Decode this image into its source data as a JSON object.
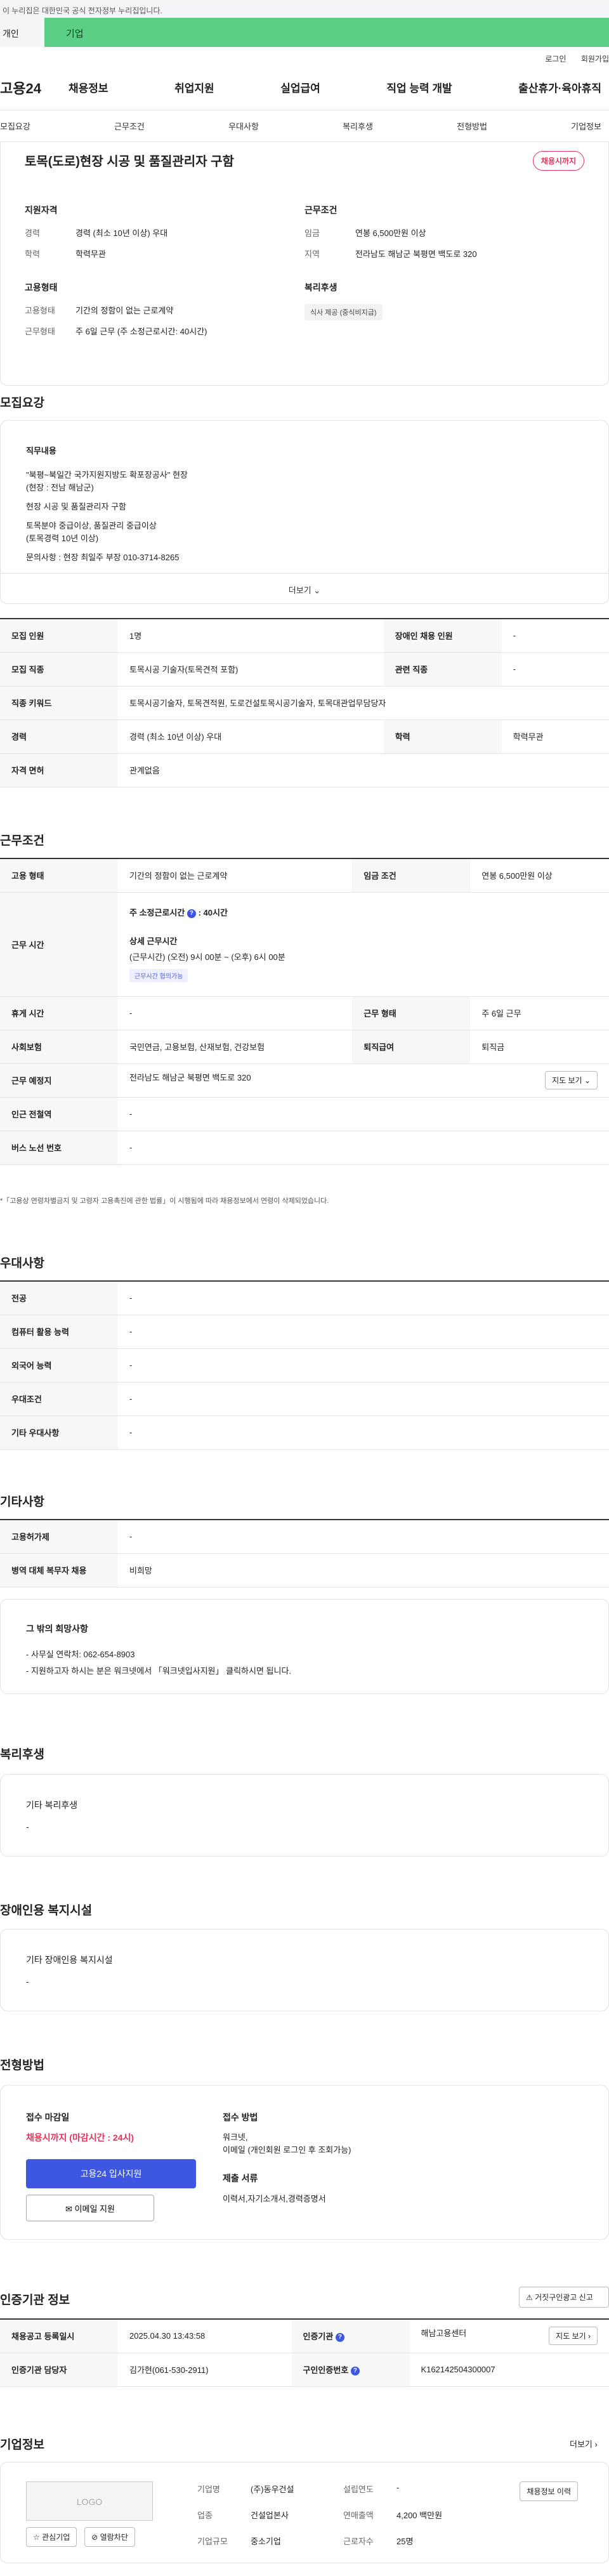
{
  "gov_banner": "이 누리집은 대한민국 공식 전자정부 누리집입니다.",
  "tabs": {
    "person": "개인",
    "company": "기업"
  },
  "util": {
    "login": "로그인",
    "join": "회원가입"
  },
  "logo": "고용24",
  "gnb": [
    "채용정보",
    "취업지원",
    "실업급여",
    "직업 능력 개발",
    "출산휴가·육아휴직"
  ],
  "anchors": [
    "모집요강",
    "근무조건",
    "우대사항",
    "복리후생",
    "전형방법",
    "기업정보"
  ],
  "summary": {
    "title": "토목(도로)현장 시공 및 품질관리자 구함",
    "badge": "채용시까지",
    "qualification": {
      "heading": "지원자격",
      "career_k": "경력",
      "career_v": "경력 (최소 10년 이상) 우대",
      "edu_k": "학력",
      "edu_v": "학력무관"
    },
    "condition": {
      "heading": "근무조건",
      "wage_k": "임금",
      "wage_v": "연봉 6,500만원 이상",
      "region_k": "지역",
      "region_v": "전라남도 해남군 북평면 백도로 320"
    },
    "employment": {
      "heading": "고용형태",
      "type_k": "고용형태",
      "type_v": "기간의 정함이 없는 근로계약",
      "work_k": "근무형태",
      "work_v": "주 6일 근무 (주 소정근로시간: 40시간)"
    },
    "welfare": {
      "heading": "복리후생",
      "chip": "식사 제공 (중식비지급)"
    }
  },
  "recruit": {
    "title": "모집요강",
    "job_label": "직무내용",
    "lines": [
      "\"북평~북일간 국가지원지방도 확포장공사\" 현장",
      "(현장 : 전남 해남군)",
      "현장 시공 및 품질관리자 구함",
      "토목분야 중급이상, 품질관리 중급이상",
      "(토목경력 10년 이상)",
      "문의사항 : 현장 최일주 부장 010-3714-8265"
    ],
    "more": "더보기",
    "table": {
      "count_k": "모집 인원",
      "count_v": "1명",
      "disabled_k": "장애인 채용 인원",
      "disabled_v": "-",
      "job_k": "모집 직종",
      "job_v": "토목시공 기술자(토목견적 포함)",
      "related_k": "관련 직종",
      "related_v": "-",
      "keyword_k": "직종 키워드",
      "keyword_v": "토목시공기술자, 토목견적원, 도로건설토목시공기술자, 토목대관업무담당자",
      "career_k": "경력",
      "career_v": "경력 (최소 10년 이상) 우대",
      "edu_k": "학력",
      "edu_v": "학력무관",
      "license_k": "자격 면허",
      "license_v": "관계없음"
    }
  },
  "work": {
    "title": "근무조건",
    "type_k": "고용 형태",
    "type_v": "기간의 정함이 없는 근로계약",
    "wage_k": "임금 조건",
    "wage_v": "연봉 6,500만원 이상",
    "hours_k": "근무 시간",
    "hours_weekly_label": "주 소정근로시간",
    "hours_weekly_v": ": 40시간",
    "hours_detail_label": "상세 근무시간",
    "hours_detail_v": "(근무시간) (오전) 9시 00분 ~ (오후) 6시 00분",
    "hours_chip": "근무시간 협의가능",
    "rest_k": "휴게 시간",
    "rest_v": "-",
    "shift_k": "근무 형태",
    "shift_v": "주 6일 근무",
    "insurance_k": "사회보험",
    "insurance_v": "국민연금, 고용보험, 산재보험, 건강보험",
    "retire_k": "퇴직급여",
    "retire_v": "퇴직금",
    "place_k": "근무 예정지",
    "place_v": "전라남도 해남군 북평면 백도로 320",
    "map_btn": "지도 보기",
    "subway_k": "인근 전철역",
    "subway_v": "-",
    "bus_k": "버스 노선 번호",
    "bus_v": "-",
    "note": "*「고용상 연령차별금지 및 고령자 고용촉진에 관한 법률」이 시행됨에 따라 채용정보에서 연령이 삭제되었습니다."
  },
  "pref": {
    "title": "우대사항",
    "rows": [
      {
        "k": "전공",
        "v": "-"
      },
      {
        "k": "컴퓨터 활용 능력",
        "v": "-"
      },
      {
        "k": "외국어 능력",
        "v": "-"
      },
      {
        "k": "우대조건",
        "v": "-"
      },
      {
        "k": "기타 우대사항",
        "v": "-"
      }
    ]
  },
  "etc": {
    "title": "기타사항",
    "hire_k": "고용허가제",
    "hire_v": "-",
    "military_k": "병역 대체 복무자 채용",
    "military_v": "비희망",
    "other_label": "그 밖의 희망사항",
    "other_lines": [
      "- 사무실 연락처: 062-654-8903",
      "- 지원하고자 하시는 분은 워크넷에서 「워크넷입사지원」 클릭하시면 됩니다."
    ]
  },
  "welfare": {
    "title": "복리후생",
    "label": "기타 복리후생",
    "value": "-"
  },
  "disabled": {
    "title": "장애인용 복지시설",
    "label": "기타 장애인용 복지시설",
    "value": "-"
  },
  "process": {
    "title": "전형방법",
    "deadline_label": "접수 마감일",
    "deadline_v": "채용시까지 (마감시간 : 24시)",
    "apply_btn": "고용24 입사지원",
    "email_btn": "이메일 지원",
    "method_label": "접수 방법",
    "method_v1": "워크넷,",
    "method_v2": "이메일 (개인회원 로그인 후 조회가능)",
    "docs_label": "제출 서류",
    "docs_v": "이력서,자기소개서,경력증명서"
  },
  "cert": {
    "title": "인증기관 정보",
    "report_btn": "거짓구인광고 신고",
    "date_k": "채용공고 등록일시",
    "date_v": "2025.04.30 13:43:58",
    "org_k": "인증기관",
    "org_v": "해남고용센터",
    "map_btn": "지도 보기",
    "manager_k": "인증기관 담당자",
    "manager_v": "김가현(061-530-2911)",
    "id_k": "구인인증번호",
    "id_v": "K162142504300007"
  },
  "company": {
    "title": "기업정보",
    "more": "더보기",
    "logo": "LOGO",
    "fav_btn": "관심기업",
    "block_btn": "열람차단",
    "name_k": "기업명",
    "name_v": "(주)동우건설",
    "year_k": "설립연도",
    "year_v": "-",
    "industry_k": "업종",
    "industry_v": "건설업본사",
    "sales_k": "연매출액",
    "sales_v": "4,200 백만원",
    "size_k": "기업규모",
    "size_v": "중소기업",
    "staff_k": "근로자수",
    "staff_v": "25명",
    "list_btn": "채용정보 이력"
  }
}
